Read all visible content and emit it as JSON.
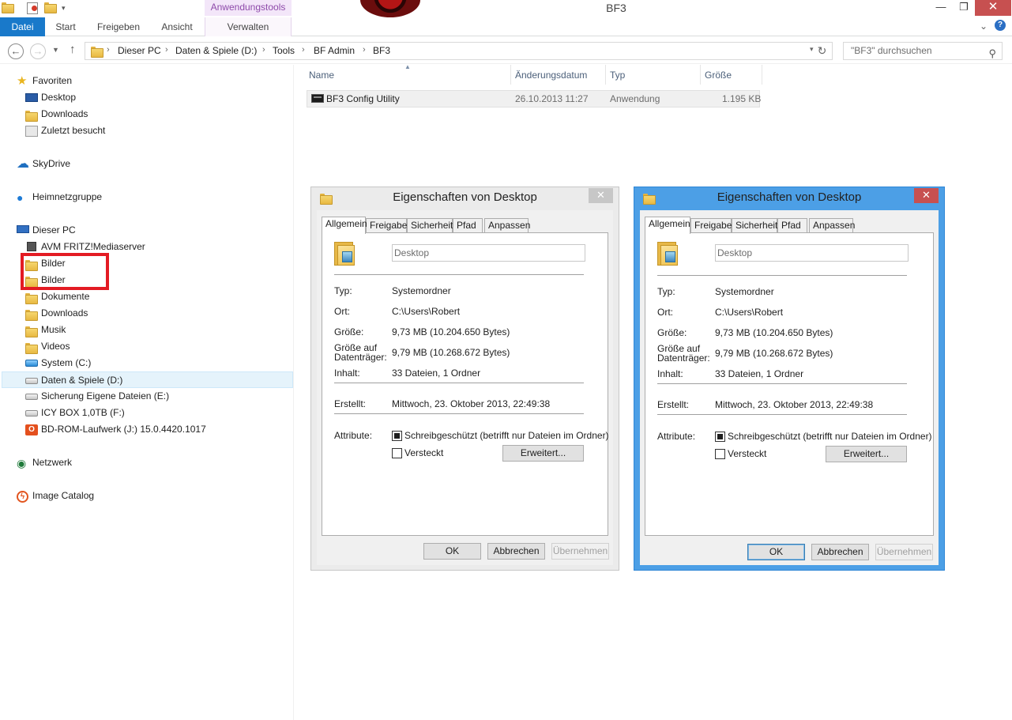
{
  "window": {
    "title": "BF3",
    "context_tab_group": "Anwendungstools",
    "minimize": "—",
    "maximize": "❐",
    "close": "✕"
  },
  "ribbon": {
    "tabs": [
      "Datei",
      "Start",
      "Freigeben",
      "Ansicht",
      "Verwalten"
    ],
    "expand": "⌄",
    "help": "?"
  },
  "address": {
    "crumbs": [
      "Dieser PC",
      "Daten & Spiele (D:)",
      "Tools",
      "BF Admin",
      "BF3"
    ],
    "separator": "›",
    "search_placeholder": "\"BF3\" durchsuchen"
  },
  "nav": {
    "favorites": {
      "label": "Favoriten",
      "items": [
        "Desktop",
        "Downloads",
        "Zuletzt besucht"
      ]
    },
    "skydrive": "SkyDrive",
    "homegroup": "Heimnetzgruppe",
    "thispc": {
      "label": "Dieser PC",
      "items": [
        "AVM FRITZ!Mediaserver",
        "Bilder",
        "Bilder",
        "Dokumente",
        "Downloads",
        "Musik",
        "Videos",
        "System (C:)",
        "Daten & Spiele (D:)",
        "Sicherung Eigene Dateien (E:)",
        "ICY BOX 1,0TB (F:)",
        "BD-ROM-Laufwerk (J:) 15.0.4420.1017"
      ],
      "selected": "Daten & Spiele (D:)"
    },
    "network": "Netzwerk",
    "image_catalog": "Image Catalog"
  },
  "filelist": {
    "columns": [
      "Name",
      "Änderungsdatum",
      "Typ",
      "Größe"
    ],
    "rows": [
      {
        "name": "BF3 Config Utility",
        "modified": "26.10.2013 11:27",
        "type": "Anwendung",
        "size": "1.195 KB"
      }
    ]
  },
  "dialog": {
    "title": "Eigenschaften von Desktop",
    "tabs": [
      "Allgemein",
      "Freigabe",
      "Sicherheit",
      "Pfad",
      "Anpassen"
    ],
    "name_value": "Desktop",
    "labels": {
      "type": "Typ:",
      "location": "Ort:",
      "size": "Größe:",
      "size_on_disk_1": "Größe auf",
      "size_on_disk_2": "Datenträger:",
      "contains": "Inhalt:",
      "created": "Erstellt:",
      "attributes": "Attribute:"
    },
    "values": {
      "type": "Systemordner",
      "location": "C:\\Users\\Robert",
      "size": "9,73 MB (10.204.650 Bytes)",
      "size_on_disk": "9,79 MB (10.268.672 Bytes)",
      "contains": "33 Dateien, 1 Ordner",
      "created": "Mittwoch, 23. Oktober 2013, 22:49:38"
    },
    "readonly_label": "Schreibgeschützt (betrifft nur Dateien im Ordner)",
    "readonly_checked": true,
    "hidden_label": "Versteckt",
    "hidden_checked": false,
    "advanced_button": "Erweitert...",
    "ok_button": "OK",
    "cancel_button": "Abbrechen",
    "apply_button": "Übernehmen"
  },
  "colors": {
    "accent": "#1979ca",
    "active_dialog_frame": "#4c9fe6",
    "highlight_box": "#e31b23",
    "context_tab": "#8e4aaa"
  }
}
